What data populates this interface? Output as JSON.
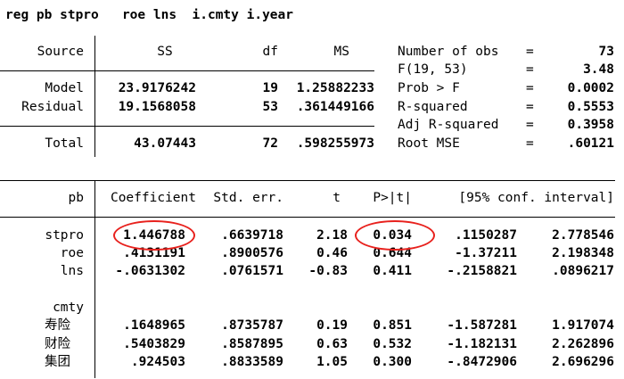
{
  "command": "reg pb stpro   roe lns  i.cmty i.year",
  "anova": {
    "headers": {
      "source": "Source",
      "ss": "SS",
      "df": "df",
      "ms": "MS"
    },
    "rows": [
      {
        "source": "Model",
        "ss": "23.9176242",
        "df": "19",
        "ms": "1.25882233"
      },
      {
        "source": "Residual",
        "ss": "19.1568058",
        "df": "53",
        "ms": ".361449166"
      }
    ],
    "total": {
      "source": "Total",
      "ss": "43.07443",
      "df": "72",
      "ms": ".598255973"
    }
  },
  "stats": [
    {
      "label": "Number of obs",
      "eq": "=",
      "value": "73"
    },
    {
      "label": "F(19, 53)",
      "eq": "=",
      "value": "3.48"
    },
    {
      "label": "Prob > F",
      "eq": "=",
      "value": "0.0002"
    },
    {
      "label": "R-squared",
      "eq": "=",
      "value": "0.5553"
    },
    {
      "label": "Adj R-squared",
      "eq": "=",
      "value": "0.3958"
    },
    {
      "label": "Root MSE",
      "eq": "=",
      "value": ".60121"
    }
  ],
  "coef_table": {
    "headers": {
      "var": "pb",
      "coef": "Coefficient",
      "se": "Std. err.",
      "t": "t",
      "p": "P>|t|",
      "ci": "[95% conf. interval]"
    },
    "rows": [
      {
        "var": "stpro",
        "coef": "1.446788",
        "se": ".6639718",
        "t": "2.18",
        "p": "0.034",
        "lo": ".1150287",
        "hi": "2.778546"
      },
      {
        "var": "roe",
        "coef": ".4131191",
        "se": ".8900576",
        "t": "0.46",
        "p": "0.644",
        "lo": "-1.37211",
        "hi": "2.198348"
      },
      {
        "var": "lns",
        "coef": "-.0631302",
        "se": ".0761571",
        "t": "-0.83",
        "p": "0.411",
        "lo": "-.2158821",
        "hi": ".0896217"
      }
    ],
    "group_label": "cmty",
    "group_rows": [
      {
        "var": "寿险",
        "coef": ".1648965",
        "se": ".8735787",
        "t": "0.19",
        "p": "0.851",
        "lo": "-1.587281",
        "hi": "1.917074"
      },
      {
        "var": "财险",
        "coef": ".5403829",
        "se": ".8587895",
        "t": "0.63",
        "p": "0.532",
        "lo": "-1.182131",
        "hi": "2.262896"
      },
      {
        "var": "集团",
        "coef": ".924503",
        "se": ".8833589",
        "t": "1.05",
        "p": "0.300",
        "lo": "-.8472906",
        "hi": "2.696296"
      }
    ]
  },
  "highlight_color": "#e8211d"
}
